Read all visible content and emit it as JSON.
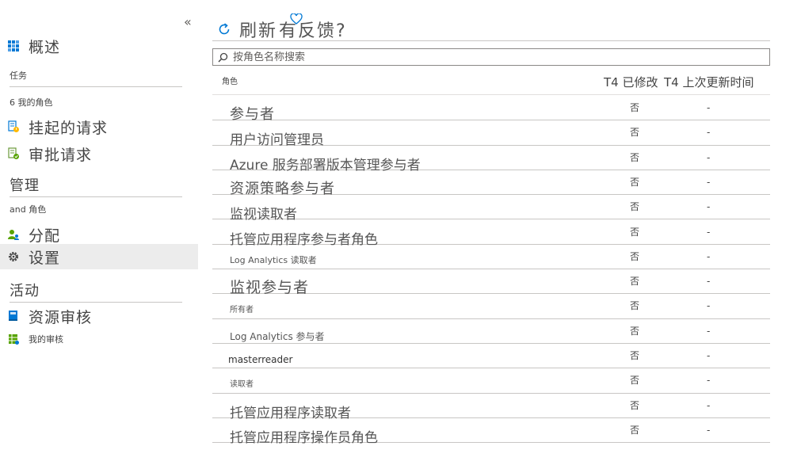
{
  "sidebar": {
    "collapse_glyph": "«",
    "overview": "概述",
    "section_tasks": "任务",
    "my_roles": "6 我的角色",
    "pending_requests": "挂起的请求",
    "approve_requests": "审批请求",
    "section_manage": "管理",
    "roles": "and 角色",
    "assignments": "分配",
    "settings": "设置",
    "section_activity": "活动",
    "resource_audit": "资源审核",
    "my_audit": "我的审核"
  },
  "toolbar": {
    "refresh": "刷新",
    "feedback": "有反馈?"
  },
  "search": {
    "placeholder": "按角色名称搜索"
  },
  "table": {
    "columns": {
      "role": "角色",
      "modified": "T4 已修改",
      "last_updated": "T4 上次更新时间"
    },
    "rows": [
      {
        "role": "参与者",
        "modified": "否",
        "last_updated": "-"
      },
      {
        "role": "用户访问管理员",
        "modified": "否",
        "last_updated": "-"
      },
      {
        "role": "Azure 服务部署版本管理参与者",
        "modified": "否",
        "last_updated": "-"
      },
      {
        "role": "资源策略参与者",
        "modified": "否",
        "last_updated": "-"
      },
      {
        "role": "监视读取者",
        "modified": "否",
        "last_updated": "-"
      },
      {
        "role": "托管应用程序参与者角色",
        "modified": "否",
        "last_updated": "-"
      },
      {
        "role": "Log Analytics 读取者",
        "modified": "否",
        "last_updated": "-"
      },
      {
        "role": "监视参与者",
        "modified": "否",
        "last_updated": "-"
      },
      {
        "role": "所有者",
        "modified": "否",
        "last_updated": "-"
      },
      {
        "role": "Log Analytics 参与者",
        "modified": "否",
        "last_updated": "-"
      },
      {
        "role": "masterreader",
        "modified": "否",
        "last_updated": "-"
      },
      {
        "role": "读取者",
        "modified": "否",
        "last_updated": "-"
      },
      {
        "role": "托管应用程序读取者",
        "modified": "否",
        "last_updated": "-"
      },
      {
        "role": "托管应用程序操作员角色",
        "modified": "否",
        "last_updated": "-"
      }
    ]
  },
  "colors": {
    "accent": "#0078d4",
    "selected_bg": "#ececec",
    "divider": "#c8c6c4"
  },
  "icons": {
    "overview": "grid-icon",
    "pending": "document-clock-icon",
    "approve": "document-check-icon",
    "assignments": "people-icon",
    "settings": "gear-icon",
    "resource_audit": "book-icon",
    "my_audit": "table-check-icon",
    "refresh": "refresh-icon",
    "feedback": "heart-icon",
    "search": "search-icon"
  }
}
